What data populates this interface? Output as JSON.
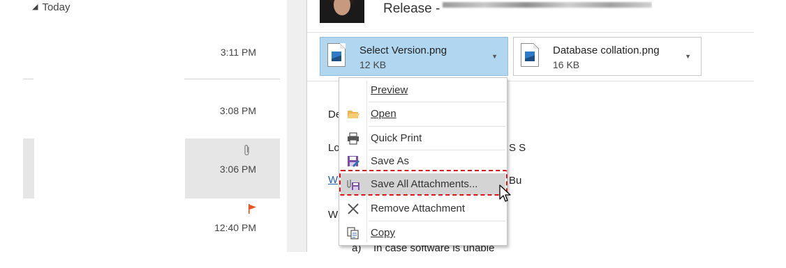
{
  "message_list": {
    "group_label": "Today",
    "items": [
      {
        "time": "3:11 PM"
      },
      {
        "time": "3:08 PM"
      },
      {
        "time": "3:06 PM",
        "has_attachment": true,
        "selected": true
      },
      {
        "time": "12:40 PM",
        "flagged": true
      }
    ]
  },
  "reading_pane": {
    "subject_prefix": "Release -",
    "attachments": [
      {
        "name": "Select Version.png",
        "size": "12 KB",
        "active": true
      },
      {
        "name": "Database collation.png",
        "size": "16 KB",
        "active": false
      }
    ],
    "body_fragments": {
      "line1": "De",
      "line2_start": "Lo",
      "line2_end": "S S",
      "line3_end": "Bu",
      "line4": "W",
      "line5_marker": "a)",
      "line5_text": "In case software is unable"
    }
  },
  "context_menu": {
    "items": [
      {
        "label": "Preview",
        "icon": "preview-icon"
      },
      {
        "label": "Open",
        "icon": "folder-open-icon"
      },
      {
        "label": "Quick Print",
        "icon": "printer-icon"
      },
      {
        "label": "Save As",
        "icon": "save-as-icon"
      },
      {
        "label": "Save All Attachments...",
        "icon": "save-all-attachments-icon",
        "highlighted": true
      },
      {
        "label": "Remove Attachment",
        "icon": "remove-icon"
      },
      {
        "label": "Copy",
        "icon": "copy-icon"
      }
    ]
  },
  "colors": {
    "attachment_selected_bg": "#b1d6f0",
    "highlight_border": "#d9151b",
    "flag": "#e8531f"
  }
}
